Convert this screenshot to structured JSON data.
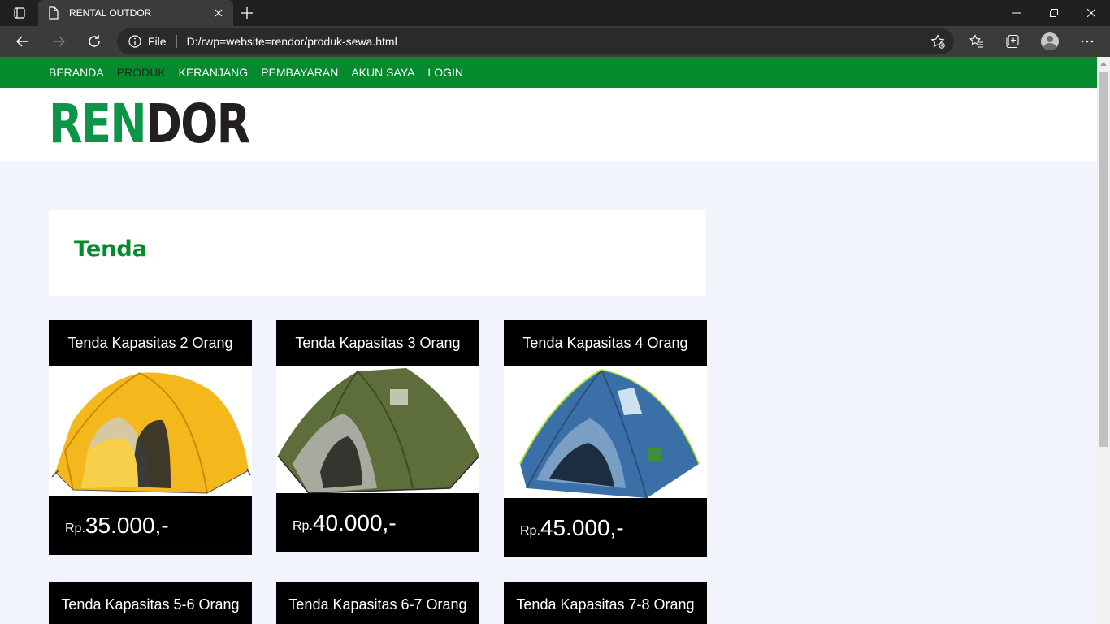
{
  "browser": {
    "tab_title": "RENTAL OUTDOR",
    "address_label": "File",
    "url": "D:/rwp=website=rendor/produk-sewa.html"
  },
  "site": {
    "nav": [
      "BERANDA",
      "PRODUK",
      "KERANJANG",
      "PEMBAYARAN",
      "AKUN SAYA",
      "LOGIN"
    ],
    "active_nav": "PRODUK",
    "logo_part1": "REN",
    "logo_part2": "DOR"
  },
  "category": {
    "title": "Tenda"
  },
  "products": [
    {
      "name": "Tenda Kapasitas 2 Orang",
      "price_prefix": "Rp.",
      "price": "35.000,-",
      "image": "yellow-dome-tent"
    },
    {
      "name": "Tenda Kapasitas 3 Orang",
      "price_prefix": "Rp.",
      "price": "40.000,-",
      "image": "green-dome-tent"
    },
    {
      "name": "Tenda Kapasitas 4 Orang",
      "price_prefix": "Rp.",
      "price": "45.000,-",
      "image": "blue-dome-tent"
    },
    {
      "name": "Tenda Kapasitas 5-6 Orang"
    },
    {
      "name": "Tenda Kapasitas 6-7 Orang"
    },
    {
      "name": "Tenda Kapasitas 7-8 Orang"
    }
  ],
  "colors": {
    "nav_green": "#058a2e",
    "logo_green": "#0c9447",
    "page_bg": "#f1f4fb"
  }
}
